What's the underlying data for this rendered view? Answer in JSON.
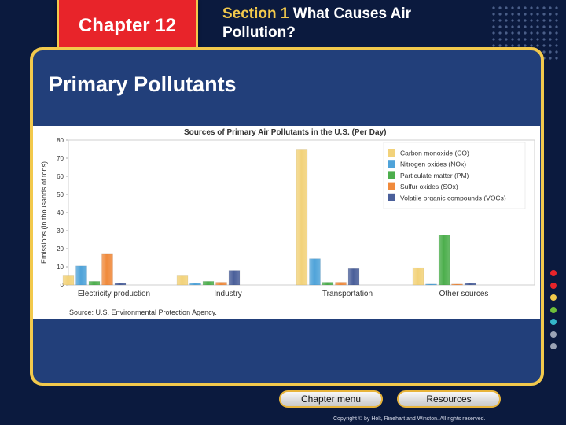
{
  "header": {
    "chapter_label": "Chapter 12",
    "section_number": "Section 1",
    "section_title": " What Causes Air Pollution?"
  },
  "slide": {
    "heading": "Primary Pollutants"
  },
  "nav": {
    "chapter_menu": "Chapter menu",
    "resources": "Resources"
  },
  "footer": {
    "copyright": "Copyright © by Holt, Rinehart and Winston. All rights reserved."
  },
  "colors": {
    "background": "#0b1a3e",
    "panel": "#223f7a",
    "panel_border": "#f2c94c",
    "chapter_tab": "#e8242a",
    "accent": "#f2c94c"
  },
  "side_dots": [
    "#e8242a",
    "#e8242a",
    "#f2c94c",
    "#6fbf3a",
    "#34b7c9",
    "#9aa3b5",
    "#9aa3b5"
  ],
  "chart_data": {
    "type": "bar",
    "title": "Sources of Primary Air Pollutants in the U.S. (Per Day)",
    "ylabel": "Emissions (in thousands of tons)",
    "xlabel": "",
    "ylim": [
      0,
      80
    ],
    "yticks": [
      0,
      10,
      20,
      30,
      40,
      50,
      60,
      70,
      80
    ],
    "grid": false,
    "legend_position": "top-right",
    "categories": [
      "Electricity production",
      "Industry",
      "Transportation",
      "Other sources"
    ],
    "series": [
      {
        "name": "Carbon monoxide (CO)",
        "color": "#f2d27a",
        "values": [
          5,
          5,
          75,
          9.5
        ]
      },
      {
        "name": "Nitrogen oxides (NOx)",
        "color": "#4fa3d9",
        "values": [
          10.5,
          1,
          14.5,
          0.5
        ]
      },
      {
        "name": "Particulate matter (PM)",
        "color": "#4cae4c",
        "values": [
          2,
          2,
          1.5,
          27.5
        ]
      },
      {
        "name": "Sulfur oxides (SOx)",
        "color": "#f08a3c",
        "values": [
          17,
          1.5,
          1.5,
          0.5
        ]
      },
      {
        "name": "Volatile organic compounds (VOCs)",
        "color": "#4a5f9a",
        "values": [
          1,
          8,
          9,
          1
        ]
      }
    ],
    "source_note": "Source: U.S. Environmental Protection Agency."
  }
}
